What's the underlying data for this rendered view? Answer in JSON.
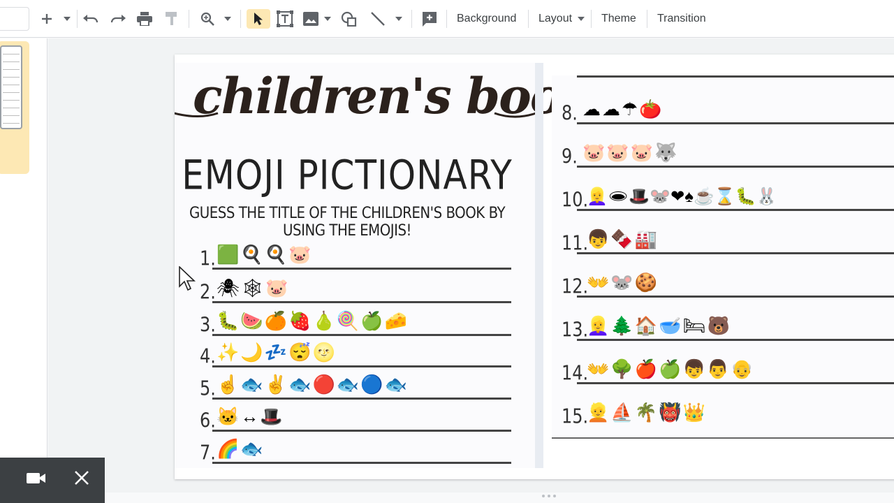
{
  "toolbar": {
    "background_label": "Background",
    "layout_label": "Layout",
    "theme_label": "Theme",
    "transition_label": "Transition"
  },
  "slide": {
    "title_script": "children's book",
    "title_sub": "EMOJI PICTIONARY",
    "instructions": "GUESS THE TITLE OF THE CHILDREN'S BOOK BY USING THE EMOJIS!",
    "questions_left": [
      {
        "num": "1.",
        "emojis": "🟩🍳🍳🐷"
      },
      {
        "num": "2.",
        "emojis": "🕷🕸🐷"
      },
      {
        "num": "3.",
        "emojis": "🐛🍉🍊🍓🍐🍭🍏🧀"
      },
      {
        "num": "4.",
        "emojis": "✨🌙💤😴🌝"
      },
      {
        "num": "5.",
        "emojis": "☝🐟✌🐟🔴🐟🔵🐟"
      },
      {
        "num": "6.",
        "emojis": "🐱↔🎩"
      },
      {
        "num": "7.",
        "emojis": "🌈🐟"
      }
    ],
    "questions_right": [
      {
        "num": "8.",
        "emojis": "☁☁☂🍅"
      },
      {
        "num": "9.",
        "emojis": "🐷🐷🐷🐺"
      },
      {
        "num": "10.",
        "emojis": "👱‍♀️🕳🎩🐭❤♠☕⌛🐛🐰"
      },
      {
        "num": "11.",
        "emojis": "👦🍫🏭"
      },
      {
        "num": "12.",
        "emojis": "👐🐭🍪"
      },
      {
        "num": "13.",
        "emojis": "👱‍♀️🌲🏠🥣🛏🐻"
      },
      {
        "num": "14.",
        "emojis": "👐🌳🍎🍏👦👨👴"
      },
      {
        "num": "15.",
        "emojis": "👱⛵🌴👹👑"
      }
    ]
  },
  "colors": {
    "accent": "#fde8b4",
    "meet_bar": "#3c4043"
  }
}
